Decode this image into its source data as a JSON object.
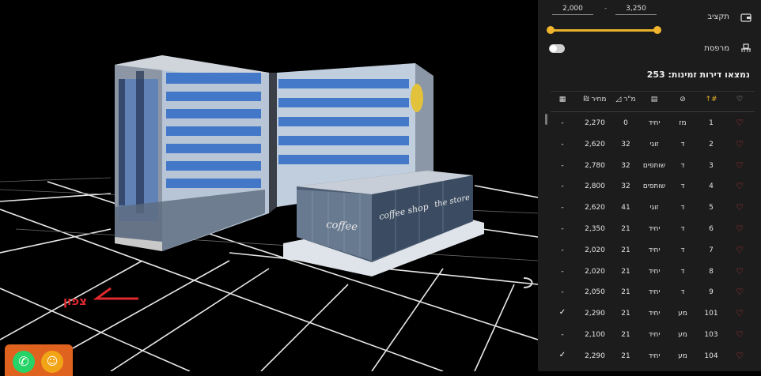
{
  "budget": {
    "label": "תקציב",
    "min": "2,000",
    "max": "3,250",
    "separator": "-",
    "icon": "wallet-icon"
  },
  "balcony": {
    "label": "מרפסת",
    "icon": "balcony-icon",
    "enabled": false
  },
  "results": {
    "text": "נמצאו דירות זמינות: 253"
  },
  "table": {
    "headers": {
      "price": "מחיר ₪",
      "sqm": "מ\"ר"
    },
    "rows": [
      {
        "num": "1",
        "dir": "מז",
        "type": "יחיד",
        "sqm": "0",
        "price": "2,270",
        "balcony": "-"
      },
      {
        "num": "2",
        "dir": "ד",
        "type": "זוגי",
        "sqm": "32",
        "price": "2,620",
        "balcony": "-"
      },
      {
        "num": "3",
        "dir": "ד",
        "type": "שותפים",
        "sqm": "32",
        "price": "2,780",
        "balcony": "-"
      },
      {
        "num": "4",
        "dir": "ד",
        "type": "שותפים",
        "sqm": "32",
        "price": "2,800",
        "balcony": "-"
      },
      {
        "num": "5",
        "dir": "ד",
        "type": "זוגי",
        "sqm": "41",
        "price": "2,620",
        "balcony": "-"
      },
      {
        "num": "6",
        "dir": "ד",
        "type": "יחיד",
        "sqm": "21",
        "price": "2,350",
        "balcony": "-"
      },
      {
        "num": "7",
        "dir": "ד",
        "type": "יחיד",
        "sqm": "21",
        "price": "2,020",
        "balcony": "-"
      },
      {
        "num": "8",
        "dir": "ד",
        "type": "יחיד",
        "sqm": "21",
        "price": "2,020",
        "balcony": "-"
      },
      {
        "num": "9",
        "dir": "ד",
        "type": "יחיד",
        "sqm": "21",
        "price": "2,050",
        "balcony": "-"
      },
      {
        "num": "101",
        "dir": "מע",
        "type": "יחיד",
        "sqm": "21",
        "price": "2,290",
        "balcony": "✓"
      },
      {
        "num": "103",
        "dir": "מע",
        "type": "יחיד",
        "sqm": "21",
        "price": "2,100",
        "balcony": "-"
      },
      {
        "num": "104",
        "dir": "מע",
        "type": "יחיד",
        "sqm": "21",
        "price": "2,290",
        "balcony": "✓"
      }
    ]
  },
  "scene": {
    "north_label": "צפון",
    "signs": [
      "coffee shop",
      "the store",
      "coffee"
    ]
  },
  "colors": {
    "accent": "#e7b12a",
    "heart": "#e03a45",
    "panel_bg": "#1c1c1c",
    "north": "#e0292c",
    "widget_bg": "#e0621f"
  }
}
